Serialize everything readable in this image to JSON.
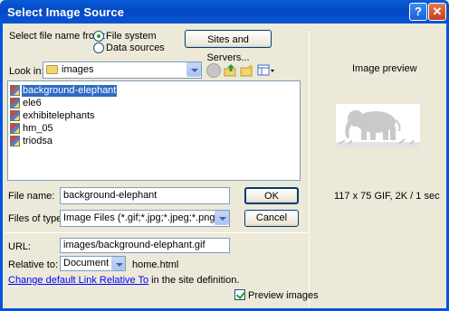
{
  "window": {
    "title": "Select Image Source",
    "help_label": "?",
    "close_label": "✕"
  },
  "select_from": {
    "label": "Select file name from:",
    "options": [
      "File system",
      "Data sources"
    ],
    "selected": "File system"
  },
  "sites_button": "Sites and Servers...",
  "look_in": {
    "label": "Look in:",
    "value": "images"
  },
  "files": [
    "background-elephant",
    "ele6",
    "exhibitelephants",
    "hm_05",
    "triodsa"
  ],
  "selected_file": "background-elephant",
  "file_name": {
    "label": "File name:",
    "value": "background-elephant"
  },
  "files_of_type": {
    "label": "Files of type:",
    "value": "Image Files (*.gif;*.jpg;*.jpeg;*.png)"
  },
  "ok_button": "OK",
  "cancel_button": "Cancel",
  "url": {
    "label": "URL:",
    "value": "images/background-elephant.gif"
  },
  "relative_to": {
    "label": "Relative to:",
    "value": "Document",
    "file": "home.html"
  },
  "change_link": {
    "link_text": "Change default Link Relative To",
    "suffix": " in the site definition."
  },
  "preview": {
    "title": "Image preview",
    "info": "117 x 75 GIF, 2K / 1 sec",
    "checkbox_label": "Preview images",
    "checked": true
  },
  "colors": {
    "titlebar": "#0449c2",
    "selection": "#316ac5",
    "dialog_bg": "#ece9d8",
    "link": "#0000ff"
  },
  "icons": [
    "folder-icon",
    "back-icon",
    "up-folder-icon",
    "new-folder-icon",
    "view-menu-icon",
    "image-file-icon",
    "elephant-thumbnail"
  ]
}
